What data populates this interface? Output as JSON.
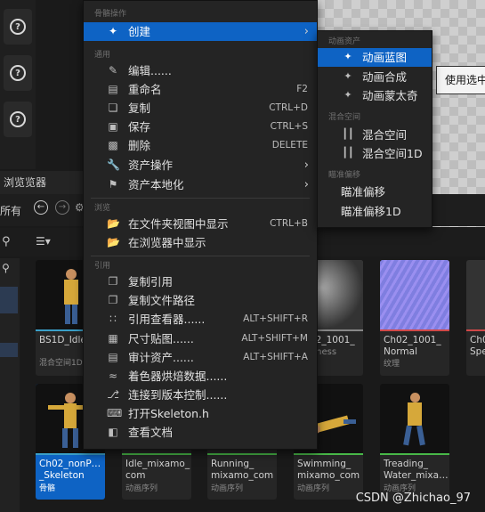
{
  "tooltip": "使用选中",
  "content_browser": {
    "tab_label": "浏览览器",
    "all_label": "所有"
  },
  "cards": [
    {
      "name": "BS1D_Idle_",
      "type": "混合空间1D",
      "accent": "#3aa0c8"
    },
    {
      "name": "Ch02_1001_",
      "type": "Business",
      "accent": "#888888"
    },
    {
      "name": "Ch02_1001_",
      "type": "Normal",
      "sub": "纹理",
      "accent": "#d04848"
    },
    {
      "name": "Ch0",
      "type": "Spe",
      "accent": "#d04848"
    },
    {
      "name": "Ch02_nonP…",
      "name2": "_Skeleton",
      "type": "骨骼",
      "accent": "#3aa0c8"
    },
    {
      "name": "Idle_mixamo_",
      "name2": "com",
      "type": "动画序列",
      "accent": "#48b848"
    },
    {
      "name": "Running_",
      "name2": "mixamo_com",
      "type": "动画序列",
      "accent": "#48b848"
    },
    {
      "name": "Swimming_",
      "name2": "mixamo_com",
      "type": "动画序列",
      "accent": "#48b848"
    },
    {
      "name": "Treading_",
      "name2": "Water_mixa…",
      "type": "动画序列",
      "accent": "#48b848"
    }
  ],
  "menu": {
    "sections": {
      "asset_ops": "骨骼操作",
      "common": "通用",
      "browse": "浏览",
      "reference": "引用"
    },
    "create": "创建",
    "edit": "编辑......",
    "rename": {
      "label": "重命名",
      "shortcut": "F2"
    },
    "copy": {
      "label": "复制",
      "shortcut": "CTRL+D"
    },
    "save": {
      "label": "保存",
      "shortcut": "CTRL+S"
    },
    "delete": {
      "label": "删除",
      "shortcut": "DELETE"
    },
    "asset_actions": "资产操作",
    "localize": "资产本地化",
    "show_in_folder": {
      "label": "在文件夹视图中显示",
      "shortcut": "CTRL+B"
    },
    "show_in_browser": "在浏览器中显示",
    "copy_ref": "复制引用",
    "copy_path": "复制文件路径",
    "ref_viewer": {
      "label": "引用查看器......",
      "shortcut": "ALT+SHIFT+R"
    },
    "size_map": {
      "label": "尺寸贴图......",
      "shortcut": "ALT+SHIFT+M"
    },
    "audit": {
      "label": "审计资产......",
      "shortcut": "ALT+SHIFT+A"
    },
    "shader_bake": "着色器烘焙数据......",
    "source_control": "连接到版本控制......",
    "open_file": "打开Skeleton.h",
    "docs": "查看文档"
  },
  "submenu": {
    "anim_assets": "动画资产",
    "anim_blueprint": "动画蓝图",
    "anim_composite": "动画合成",
    "anim_montage": "动画蒙太奇",
    "blend_space": "混合空间",
    "bs1": "混合空间",
    "bs1d": "混合空间1D",
    "aim_offset_section": "瞄准偏移",
    "aim_offset": "瞄准偏移",
    "aim_offset_1d": "瞄准偏移1D"
  },
  "watermark": "CSDN @Zhichao_97"
}
